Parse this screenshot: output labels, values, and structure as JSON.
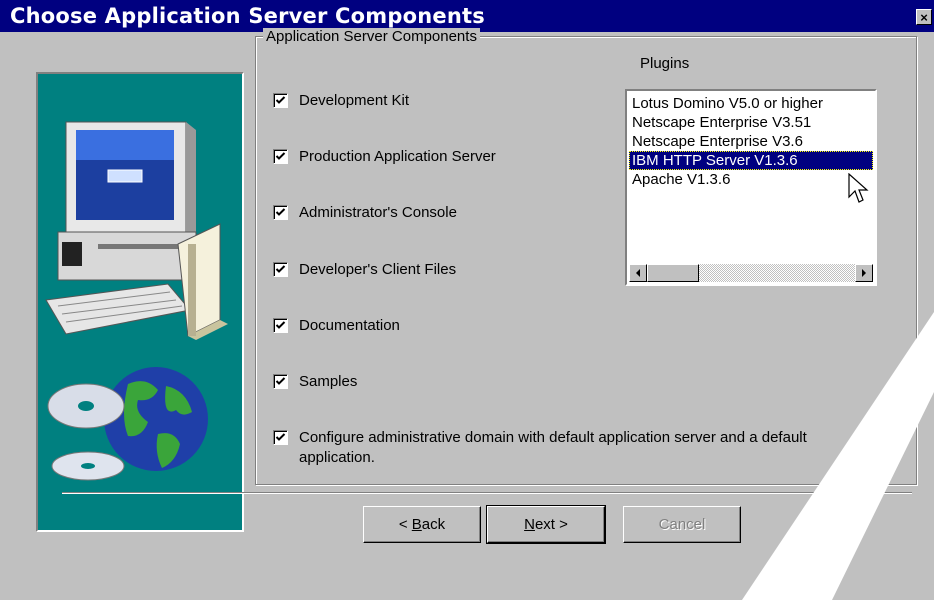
{
  "window": {
    "title": "Choose Application Server Components",
    "close_glyph": "×"
  },
  "components": {
    "group_label": "Application Server Components",
    "items": [
      {
        "label": "Development Kit",
        "checked": true
      },
      {
        "label": "Production Application Server",
        "checked": true
      },
      {
        "label": "Administrator's Console",
        "checked": true
      },
      {
        "label": "Developer's Client Files",
        "checked": true
      },
      {
        "label": "Documentation",
        "checked": true
      },
      {
        "label": "Samples",
        "checked": true
      }
    ],
    "configure_line1": "Configure administrative domain with default application server and a default",
    "configure_line2": "application.",
    "configure_checked": true
  },
  "plugins": {
    "label": "Plugins",
    "items": [
      "Lotus Domino V5.0 or higher",
      "Netscape Enterprise V3.51",
      "Netscape Enterprise V3.6",
      "IBM HTTP Server V1.3.6",
      "Apache V1.3.6"
    ],
    "selected": "IBM HTTP Server V1.3.6"
  },
  "buttons": {
    "back_prefix": "< ",
    "back_key": "B",
    "back_rest": "ack",
    "next_key": "N",
    "next_rest": "ext >",
    "cancel": "Cancel"
  },
  "icons": {
    "close": "close-icon",
    "checkbox": "checkmark-icon",
    "scroll_left": "scroll-left-arrow-icon",
    "scroll_right": "scroll-right-arrow-icon",
    "cursor": "mouse-pointer-icon"
  },
  "colors": {
    "titlebar": "#000080",
    "selection": "#000080",
    "side_panel": "#008080",
    "dialog": "#c0c0c0"
  }
}
